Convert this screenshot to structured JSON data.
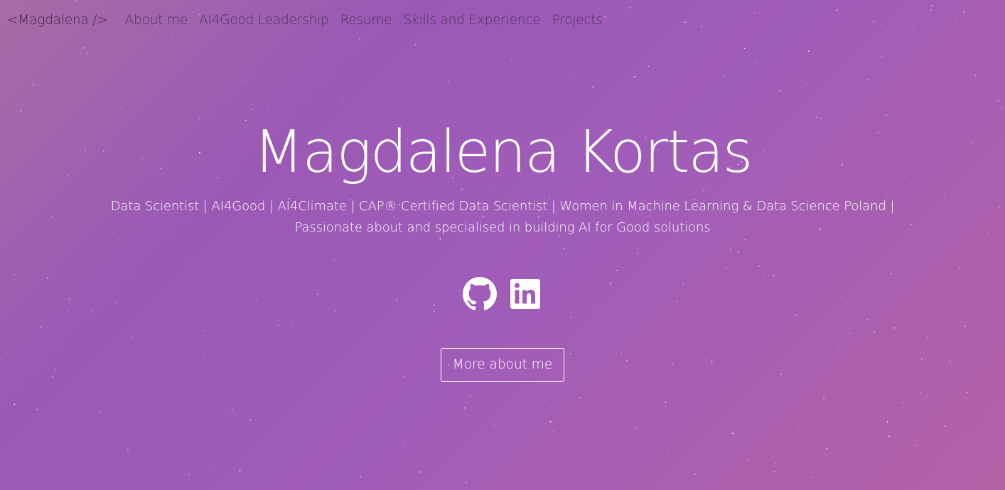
{
  "colors": {
    "background_start": "#a86ca6",
    "background_mid": "#9b59b6",
    "background_end": "#b462a7",
    "text": "#ffffff",
    "nav_text": "#4e3258"
  },
  "navbar": {
    "brand": "<Magdalena />",
    "links": [
      {
        "label": "About me"
      },
      {
        "label": "AI4Good Leadership"
      },
      {
        "label": "Resume"
      },
      {
        "label": "Skills and Experience"
      },
      {
        "label": "Projects"
      }
    ]
  },
  "hero": {
    "title": "Magdalena Kortas",
    "subtitle": "Data Scientist | AI4Good | AI4Climate | CAP® Certified Data Scientist | Women in Machine Learning & Data Science Poland | Passionate about and specialised in building AI for Good solutions"
  },
  "social": {
    "icons": [
      "github-icon",
      "linkedin-icon"
    ]
  },
  "cta": {
    "label": "More about me"
  }
}
